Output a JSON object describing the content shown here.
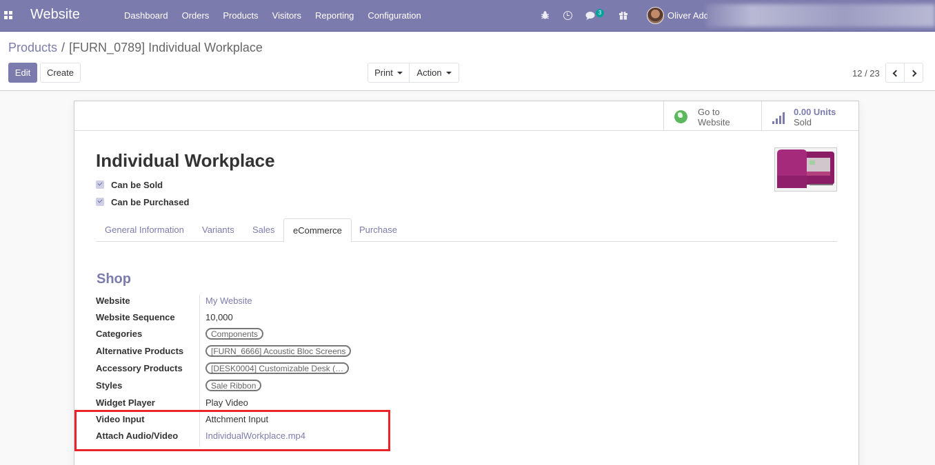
{
  "navbar": {
    "brand": "Website",
    "menu": [
      "Dashboard",
      "Orders",
      "Products",
      "Visitors",
      "Reporting",
      "Configuration"
    ],
    "chat_count": "3",
    "user_name": "Oliver Add",
    "bg_color": "#7c7bad"
  },
  "breadcrumb": {
    "parent": "Products",
    "separator": "/",
    "current": "[FURN_0789] Individual Workplace"
  },
  "toolbar": {
    "edit_label": "Edit",
    "create_label": "Create",
    "print_label": "Print",
    "action_label": "Action",
    "pager": "12 / 23"
  },
  "stat_buttons": {
    "website_line1": "Go to",
    "website_line2": "Website",
    "sold_value": "0.00 Units",
    "sold_label": "Sold"
  },
  "product": {
    "name": "Individual Workplace",
    "can_be_sold_label": "Can be Sold",
    "can_be_sold": true,
    "can_be_purchased_label": "Can be Purchased",
    "can_be_purchased": true
  },
  "tabs": [
    {
      "label": "General Information",
      "active": false
    },
    {
      "label": "Variants",
      "active": false
    },
    {
      "label": "Sales",
      "active": false
    },
    {
      "label": "eCommerce",
      "active": true
    },
    {
      "label": "Purchase",
      "active": false
    }
  ],
  "shop": {
    "title": "Shop",
    "fields": {
      "website": {
        "label": "Website",
        "value": "My Website"
      },
      "sequence": {
        "label": "Website Sequence",
        "value": "10,000"
      },
      "categories": {
        "label": "Categories",
        "value": "Components"
      },
      "alternative": {
        "label": "Alternative Products",
        "value": "[FURN_6666] Acoustic Bloc Screens"
      },
      "accessory": {
        "label": "Accessory Products",
        "value": "[DESK0004] Customizable Desk (…"
      },
      "styles": {
        "label": "Styles",
        "value": "Sale Ribbon"
      },
      "widget": {
        "label": "Widget Player",
        "value": "Play Video"
      },
      "video_input": {
        "label": "Video Input",
        "value": "Attchment Input"
      },
      "attach": {
        "label": "Attach Audio/Video",
        "value": "IndividualWorkplace.mp4"
      }
    }
  },
  "colors": {
    "accent": "#7c7bad",
    "highlight": "#e8242a",
    "website_icon": "#5cb85c"
  }
}
